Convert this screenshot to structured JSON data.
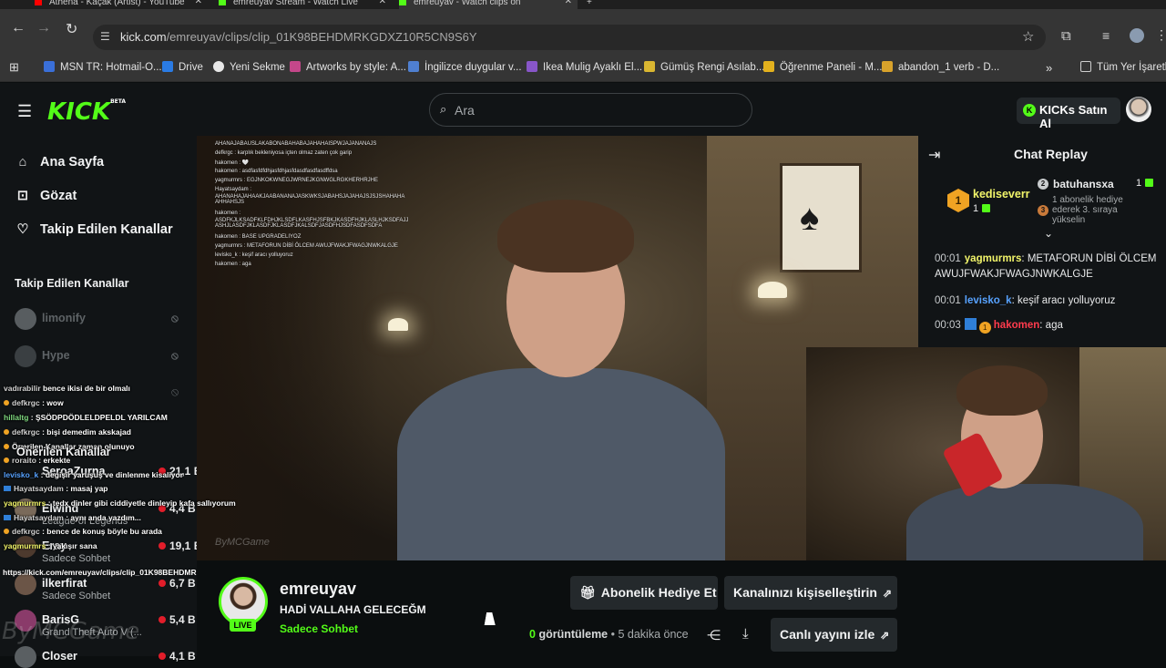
{
  "browser": {
    "tabs": [
      {
        "title": "Athena - Kaçak (Artist) - YouTube"
      },
      {
        "title": "emreuyav Stream - Watch Live"
      },
      {
        "title": "emreuyav - Watch clips on"
      }
    ],
    "url_host": "kick.com",
    "url_path": "/emreuyav/clips/clip_01K98BEHDMRKGDXZ10R5CN9S6Y",
    "bookmarks": [
      "MSN TR: Hotmail-O...",
      "Drive",
      "Yeni Sekme",
      "Artworks by style: A...",
      "İngilizce duygular v...",
      "Ikea Mulig Ayaklı El...",
      "Gümüş Rengi Asılab...",
      "Öğrenme Paneli - M...",
      "abandon_1 verb - D..."
    ],
    "bookmarks_more": "»",
    "all_bookmarks": "Tüm Yer İşaretle"
  },
  "kick": {
    "logo": "KICK",
    "logo_beta": "BETA",
    "search_placeholder": "Ara",
    "kicks_button": "KICKs Satın Al"
  },
  "sidebar": {
    "nav": [
      {
        "label": "Ana Sayfa",
        "icon": "home-icon"
      },
      {
        "label": "Gözat",
        "icon": "browse-icon"
      },
      {
        "label": "Takip Edilen Kanallar",
        "icon": "heart-icon"
      }
    ],
    "followed_heading": "Takip Edilen Kanallar",
    "followed": [
      {
        "name": "limonify"
      },
      {
        "name": "Hype"
      }
    ],
    "recommended_heading": "Önerilen Kanallar",
    "recommended": [
      {
        "name": "SeroaZurna",
        "category": "",
        "viewers": "21,1 B"
      },
      {
        "name": "Elwind",
        "category": "League of Legends",
        "viewers": "4,4 B"
      },
      {
        "name": "Eray",
        "category": "Sadece Sohbet",
        "viewers": "19,1 B"
      },
      {
        "name": "ilkerfirat",
        "category": "Sadece Sohbet",
        "viewers": "6,7 B"
      },
      {
        "name": "BarisG",
        "category": "Grand Theft Auto V (...",
        "viewers": "5,4 B"
      },
      {
        "name": "Closer",
        "category": "",
        "viewers": "4,1 B"
      }
    ]
  },
  "overlay_chat": [
    {
      "user": "vadırabilir",
      "text": "bence ikisi de bir olmalı"
    },
    {
      "user": "defkrgc",
      "text": ": wow"
    },
    {
      "user": "hillaltg",
      "text": ": ŞSÖDPDÖDLELDPELDL YARILCAM"
    },
    {
      "user": "defkrgc",
      "text": ": bişi demedim akskajad"
    },
    {
      "user": "",
      "text": "Önerilen Kanallar zaman olunuyo"
    },
    {
      "user": "roraito",
      "text": ": erkekte"
    },
    {
      "user": "levisko_k",
      "text": ": degişir yaruşuş ve dinlenme kisaliyor"
    },
    {
      "user": "Hayatsaydam",
      "text": ": masaj yap"
    },
    {
      "user": "yagmurmrs",
      "text": ": tedx dinler gibi ciddiyetle dinleyip kafa sallıyorum"
    },
    {
      "user": "Hayatsaydam",
      "text": ": aynı anda yazdım..."
    },
    {
      "user": "defkrgc",
      "text": ": bence de konuş böyle bu arada"
    },
    {
      "user": "yagmurmrs",
      "text": ": yakışır sana"
    }
  ],
  "overlay_url": "https://kick.com/emreuyav/clips/clip_01K98BEHDMRKGDXZ10R5CN9S6Y",
  "watermark": "ByMCGame",
  "video_chat": [
    "AHANAJABAUSLAKABONABAHABAJAHAHAISPWJAJANANAJS",
    "defkrgc : karplık bekleniyosa içten olmaz zaten çok garip",
    "hakomen : 🤍",
    "hakomen : asdfasfdfdhjasfdhjasfdasdfasdfasdffdsa",
    "yagmurmrs : EGJNKOKWNEGJWRNEJKGNWGLRGKHERHRJHE",
    "Hayatsaydam :",
    "AHANAHAJAHAAKJAABANANAJASKWKSJABAHSJAJAHAJSJSJSHAHAHA AHHAHSJS",
    "hakomen :",
    "ASDFKJLKSADFKLFDHJKLSDFLKASFHJSFBKJKASDFHJKLASLHJKSDFAJJ ASHJLASDFJKLASDFJKLASDFJKALSDFJASDFHJSDFASDFSDFA",
    "hakomen : BASE UPGRADELIYOZ",
    "yagmurmrs : METAFORUN DİBİ ÖLCEM AWUJFWAKJFWAGJNWKALGJE",
    "levisko_k : keşif aracı yolluyoruz",
    "hakomen : aga"
  ],
  "chat_replay": {
    "title": "Chat Replay",
    "gifter_name": "kediseverr",
    "gifter_count": "1",
    "gifter_rank": "1",
    "second_rank": "2",
    "second_name": "batuhansxa",
    "second_count": "1",
    "third_rank": "3",
    "third_text": "1 abonelik hediye ederek 3. sıraya yükselin",
    "messages": [
      {
        "time": "00:01",
        "user": "yagmurmrs",
        "text": "METAFORUN DİBİ ÖLCEM AWUJFWAKJFWAGJNWKALGJE"
      },
      {
        "time": "00:01",
        "user": "levisko_k",
        "text": "keşif aracı yolluyoruz"
      },
      {
        "time": "00:03",
        "user": "hakomen",
        "text": "aga",
        "badge": "1"
      }
    ]
  },
  "stream": {
    "streamer": "emreuyav",
    "live": "LIVE",
    "title": "HADİ VALLAHA GELECEĞM",
    "category": "Sadece Sohbet",
    "views_count": "0",
    "views_label": "görüntüleme",
    "time_ago": "5 dakika önce",
    "gift_button": "Abonelik Hediye Et",
    "customize_button": "Kanalınızı kişiselleştirin",
    "watch_live_button": "Canlı yayını izle"
  },
  "colors": {
    "brand": "#53fc18",
    "background": "#0b0e0f",
    "panel": "#111416"
  }
}
